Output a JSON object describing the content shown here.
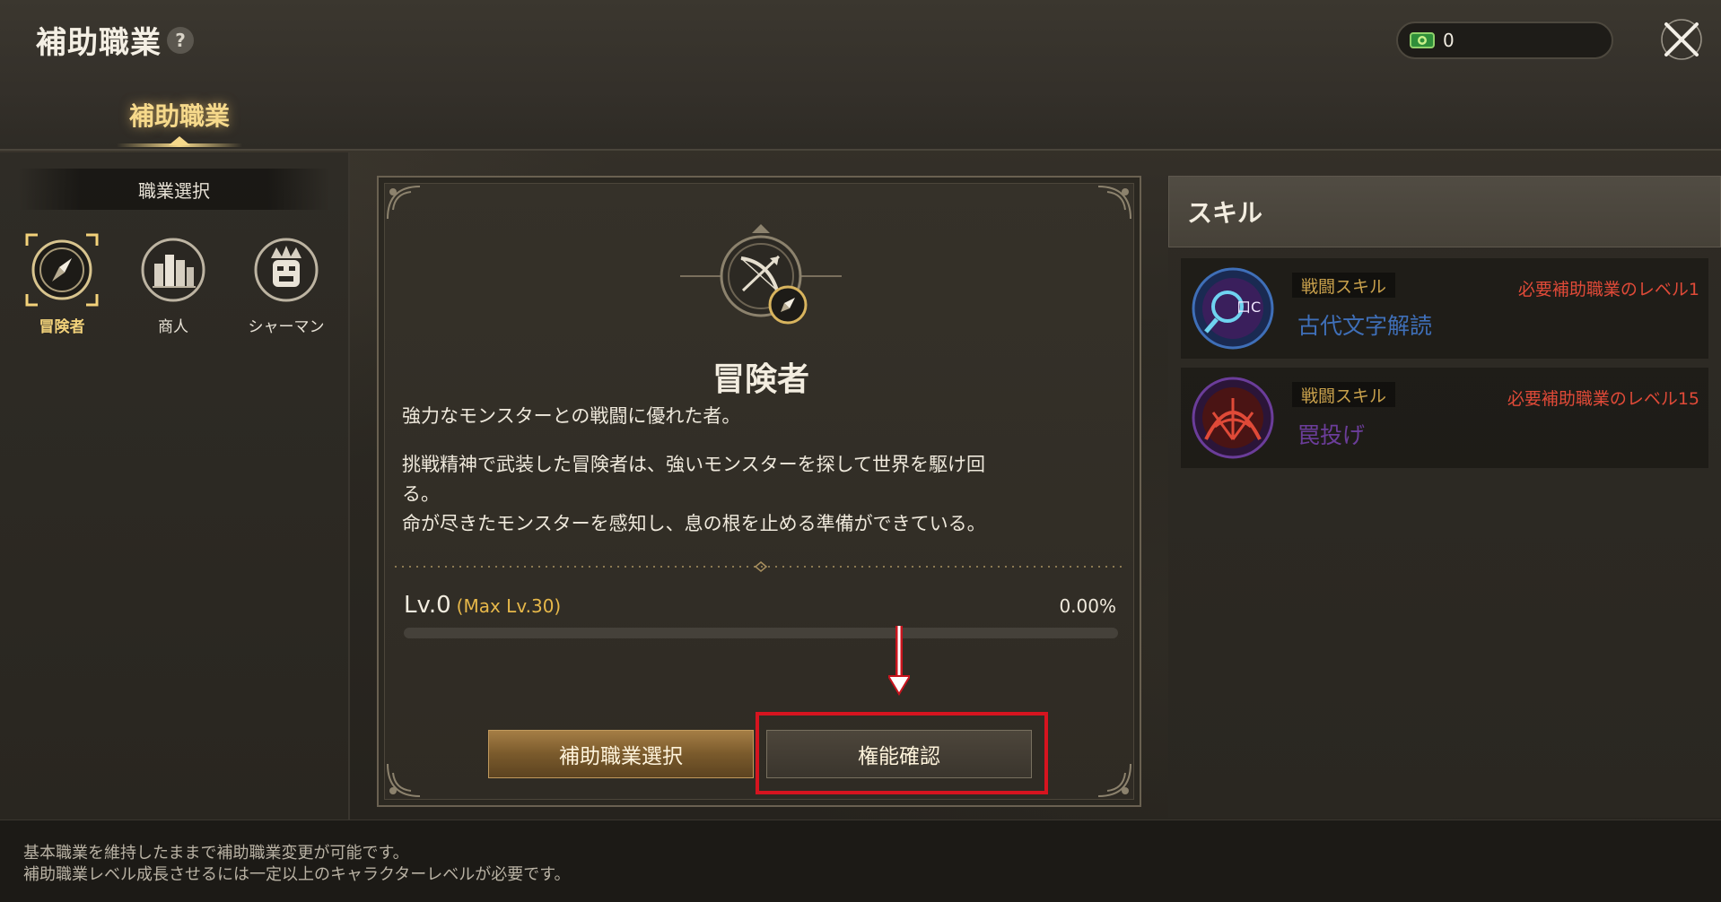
{
  "header": {
    "title": "補助職業",
    "help_symbol": "?",
    "currency_value": "0",
    "close_icon": "close-x-icon",
    "currency_icon": "green-ticket-icon"
  },
  "tabs": [
    {
      "label": "補助職業",
      "active": true
    }
  ],
  "sidebar": {
    "header": "職業選択",
    "jobs": [
      {
        "label": "冒険者",
        "icon": "compass-icon",
        "selected": true
      },
      {
        "label": "商人",
        "icon": "coins-icon",
        "selected": false
      },
      {
        "label": "シャーマン",
        "icon": "mask-icon",
        "selected": false
      }
    ]
  },
  "job_detail": {
    "emblem_icon": "bow-emblem-icon",
    "name": "冒険者",
    "summary": "強力なモンスターとの戦闘に優れた者。",
    "description_line1": "挑戦精神で武装した冒険者は、強いモンスターを探して世界を駆け回",
    "description_line2": "る。",
    "description_line3": "命が尽きたモンスターを感知し、息の根を止める準備ができている。",
    "level_label": "Lv.0",
    "max_level_label": "(Max Lv.30)",
    "progress_text": "0.00%",
    "progress_value": 0
  },
  "buttons": {
    "select_label": "補助職業選択",
    "check_label": "権能確認"
  },
  "skills": {
    "header": "スキル",
    "items": [
      {
        "type": "戦闘スキル",
        "requirement": "必要補助職業のレベル1",
        "name": "古代文字解読",
        "name_color": "#3f6fb8",
        "icon": "ancient-script-icon"
      },
      {
        "type": "戦闘スキル",
        "requirement": "必要補助職業のレベル15",
        "name": "罠投げ",
        "name_color": "#6b3d9a",
        "icon": "trap-net-icon"
      }
    ]
  },
  "footer": {
    "line1": "基本職業を維持したままで補助職業変更が可能です。",
    "line2": "補助職業レベル成長させるには一定以上のキャラクターレベルが必要です。"
  }
}
